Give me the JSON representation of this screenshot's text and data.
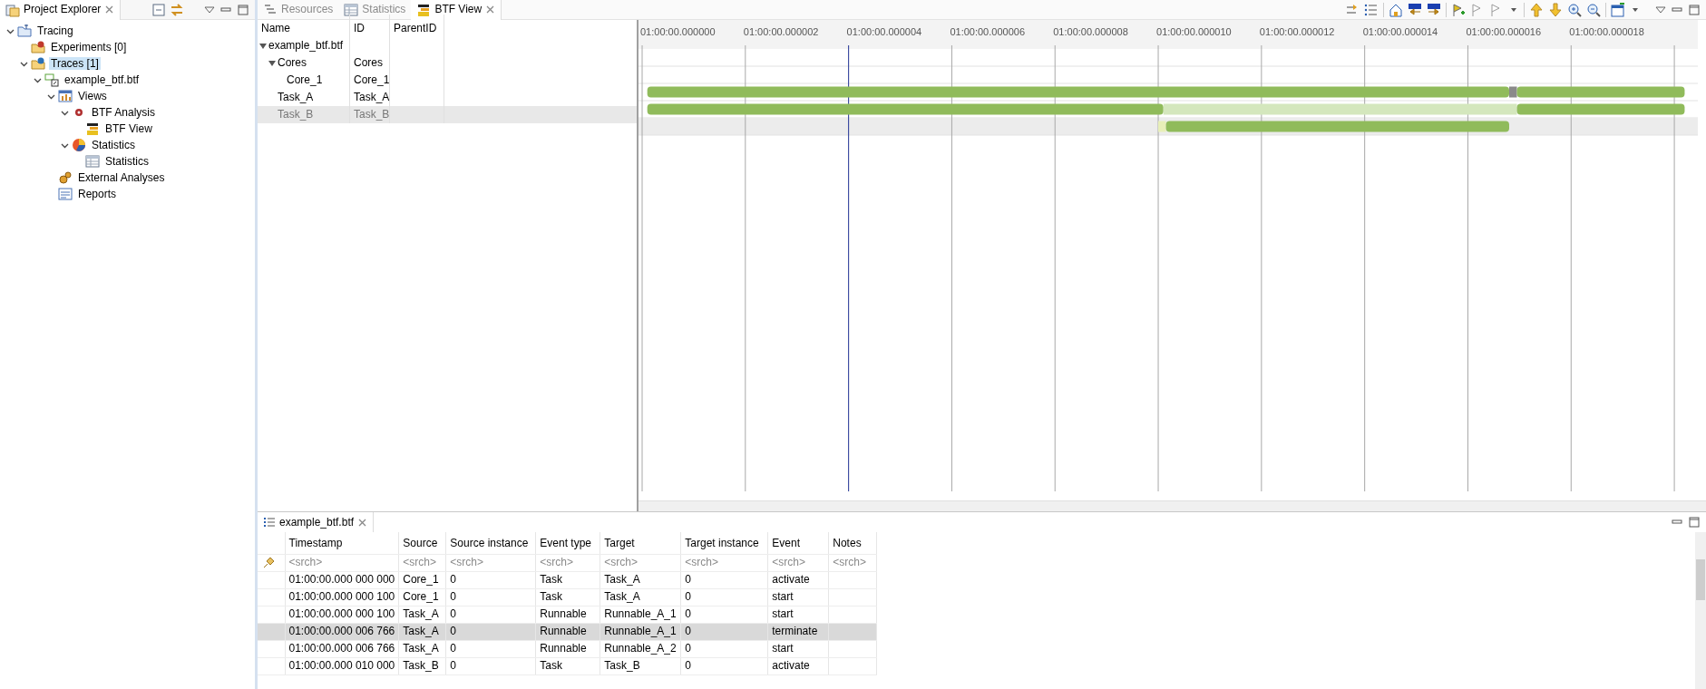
{
  "explorer": {
    "title": "Project Explorer",
    "tree": [
      {
        "label": "Tracing",
        "kind": "project",
        "expanded": true,
        "selected": false,
        "children": [
          {
            "label": "Experiments [0]",
            "kind": "experiments",
            "selected": false
          },
          {
            "label": "Traces [1]",
            "kind": "traces",
            "expanded": true,
            "selected": true,
            "children": [
              {
                "label": "example_btf.btf",
                "kind": "trace",
                "expanded": true,
                "selected": false,
                "children": [
                  {
                    "label": "Views",
                    "kind": "views",
                    "expanded": true,
                    "selected": false,
                    "children": [
                      {
                        "label": "BTF Analysis",
                        "kind": "analysis",
                        "expanded": true,
                        "selected": false,
                        "children": [
                          {
                            "label": "BTF View",
                            "kind": "view",
                            "selected": false
                          }
                        ]
                      },
                      {
                        "label": "Statistics",
                        "kind": "statistics",
                        "expanded": true,
                        "selected": false,
                        "children": [
                          {
                            "label": "Statistics",
                            "kind": "table",
                            "selected": false
                          }
                        ]
                      }
                    ]
                  },
                  {
                    "label": "External Analyses",
                    "kind": "external",
                    "selected": false
                  },
                  {
                    "label": "Reports",
                    "kind": "reports",
                    "selected": false
                  }
                ]
              }
            ]
          }
        ]
      }
    ]
  },
  "editor_tabs": [
    {
      "label": "Resources",
      "kind": "resources",
      "selected": false
    },
    {
      "label": "Statistics",
      "kind": "table",
      "selected": false
    },
    {
      "label": "BTF View",
      "kind": "view",
      "selected": true
    }
  ],
  "btf_view": {
    "columns": [
      "Name",
      "ID",
      "ParentID"
    ],
    "rows": [
      {
        "name": "example_btf.btf",
        "expanded": true,
        "selected": false,
        "children": [
          {
            "name": "Cores",
            "id": "Cores",
            "expanded": true,
            "selected": false,
            "children": [
              {
                "name": "Core_1",
                "id": "Core_1",
                "selected": false
              }
            ]
          },
          {
            "name": "Task_A",
            "id": "Task_A",
            "selected": false
          },
          {
            "name": "Task_B",
            "id": "Task_B",
            "selected": true
          }
        ]
      }
    ],
    "time_labels": [
      "01:00:00.000000",
      "01:00:00.000002",
      "01:00:00.000004",
      "01:00:00.000006",
      "01:00:00.000008",
      "01:00:00.000010",
      "01:00:00.000012",
      "01:00:00.000014",
      "01:00:00.000016",
      "01:00:00.000018"
    ]
  },
  "events": {
    "title": "example_btf.btf",
    "columns": [
      "Timestamp",
      "Source",
      "Source instance",
      "Event type",
      "Target",
      "Target instance",
      "Event",
      "Notes"
    ],
    "filters": [
      {
        "placeholder": "<srch>"
      },
      {
        "placeholder": "<srch>"
      },
      {
        "placeholder": "<srch>"
      },
      {
        "placeholder": "<srch>"
      },
      {
        "placeholder": "<srch>"
      },
      {
        "placeholder": "<srch>"
      },
      {
        "placeholder": "<srch>"
      },
      {
        "placeholder": "<srch>"
      }
    ],
    "rows": [
      {
        "cells": [
          "01:00:00.000 000 000",
          "Core_1",
          "0",
          "Task",
          "Task_A",
          "0",
          "activate",
          ""
        ],
        "selected": false
      },
      {
        "cells": [
          "01:00:00.000 000 100",
          "Core_1",
          "0",
          "Task",
          "Task_A",
          "0",
          "start",
          ""
        ],
        "selected": false
      },
      {
        "cells": [
          "01:00:00.000 000 100",
          "Task_A",
          "0",
          "Runnable",
          "Runnable_A_1",
          "0",
          "start",
          ""
        ],
        "selected": false
      },
      {
        "cells": [
          "01:00:00.000 006 766",
          "Task_A",
          "0",
          "Runnable",
          "Runnable_A_1",
          "0",
          "terminate",
          ""
        ],
        "selected": true
      },
      {
        "cells": [
          "01:00:00.000 006 766",
          "Task_A",
          "0",
          "Runnable",
          "Runnable_A_2",
          "0",
          "start",
          ""
        ],
        "selected": false
      },
      {
        "cells": [
          "01:00:00.000 010 000",
          "Task_B",
          "0",
          "Task",
          "Task_B",
          "0",
          "activate",
          ""
        ],
        "selected": false
      }
    ]
  }
}
